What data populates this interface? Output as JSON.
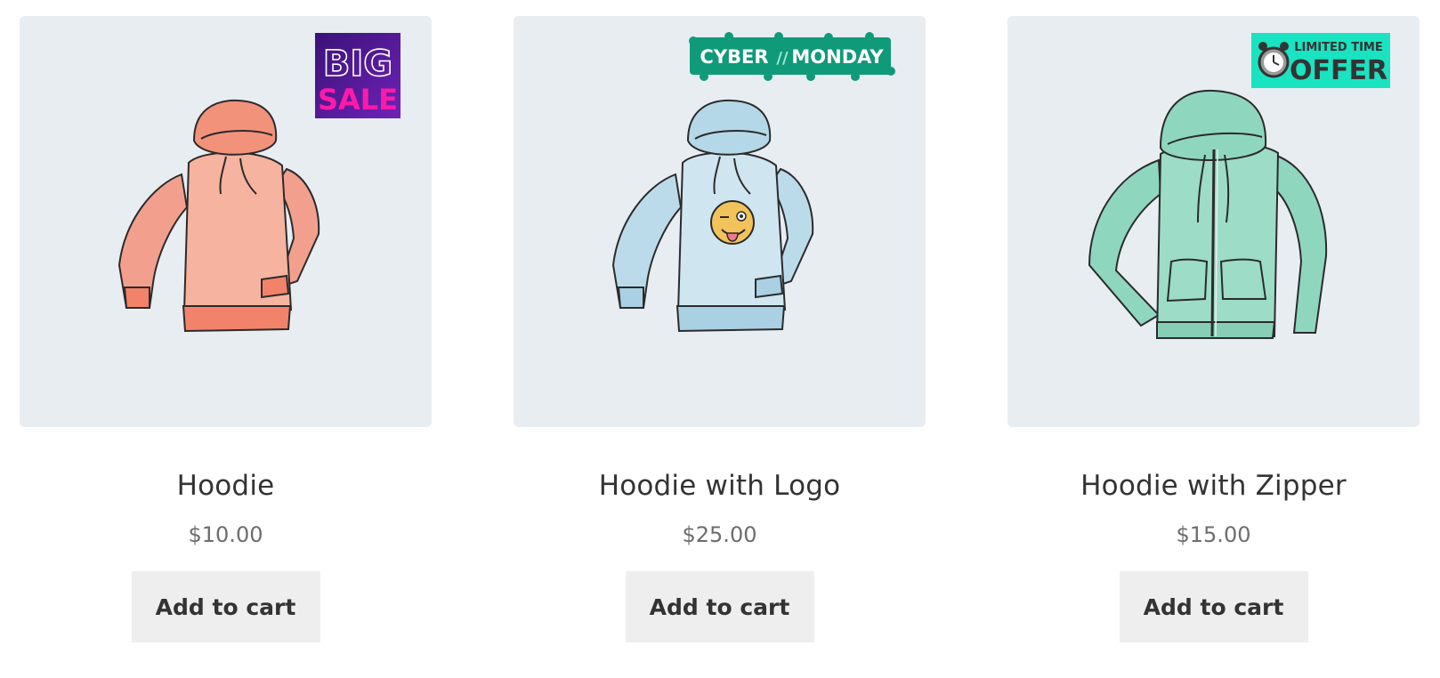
{
  "colors": {
    "image_bg": "#e8edf2",
    "button_bg": "#eeeeee",
    "title_text": "#333333",
    "price_text": "#6d6d6d",
    "big_sale_bg": "#5a1aa0",
    "big_sale_accent": "#ff1aa8",
    "cyber_monday_bg": "#0f9a7a",
    "limited_offer_bg": "#19e3c0"
  },
  "products": [
    {
      "name": "Hoodie",
      "price": "$10.00",
      "button_label": "Add to cart",
      "image_icon": "orange-hoodie-image",
      "badge": {
        "icon": "big-sale-badge",
        "line1": "BIG",
        "line2": "SALE"
      }
    },
    {
      "name": "Hoodie with Logo",
      "price": "$25.00",
      "button_label": "Add to cart",
      "image_icon": "blue-hoodie-with-emoji-image",
      "badge": {
        "icon": "cyber-monday-badge",
        "line1": "CYBER",
        "separator": "//",
        "line2": "MONDAY"
      }
    },
    {
      "name": "Hoodie with Zipper",
      "price": "$15.00",
      "button_label": "Add to cart",
      "image_icon": "green-zip-hoodie-image",
      "badge": {
        "icon": "limited-time-offer-badge",
        "line1": "LIMITED TIME",
        "line2": "OFFER"
      }
    }
  ]
}
